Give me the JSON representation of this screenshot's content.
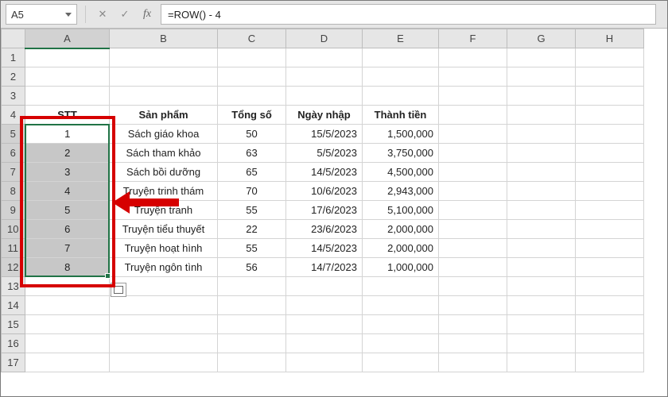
{
  "namebox": "A5",
  "formula": "=ROW() - 4",
  "columns": [
    "A",
    "B",
    "C",
    "D",
    "E",
    "F",
    "G",
    "H"
  ],
  "row_count": 17,
  "headers": {
    "stt": "STT",
    "sanpham": "Sản phẩm",
    "tongso": "Tổng số",
    "ngaynhap": "Ngày nhập",
    "thanhtien": "Thành tiền"
  },
  "rows": [
    {
      "stt": "1",
      "sp": "Sách giáo khoa",
      "ts": "50",
      "ng": "15/5/2023",
      "tt": "1,500,000"
    },
    {
      "stt": "2",
      "sp": "Sách tham khảo",
      "ts": "63",
      "ng": "5/5/2023",
      "tt": "3,750,000"
    },
    {
      "stt": "3",
      "sp": "Sách bồi dưỡng",
      "ts": "65",
      "ng": "14/5/2023",
      "tt": "4,500,000"
    },
    {
      "stt": "4",
      "sp": "Truyện trinh thám",
      "ts": "70",
      "ng": "10/6/2023",
      "tt": "2,943,000"
    },
    {
      "stt": "5",
      "sp": "Truyện tranh",
      "ts": "55",
      "ng": "17/6/2023",
      "tt": "5,100,000"
    },
    {
      "stt": "6",
      "sp": "Truyện tiểu thuyết",
      "ts": "22",
      "ng": "23/6/2023",
      "tt": "2,000,000"
    },
    {
      "stt": "7",
      "sp": "Truyện hoạt hình",
      "ts": "55",
      "ng": "14/5/2023",
      "tt": "2,000,000"
    },
    {
      "stt": "8",
      "sp": "Truyện ngôn tình",
      "ts": "56",
      "ng": "14/7/2023",
      "tt": "1,000,000"
    }
  ],
  "chart_data": {
    "type": "table",
    "columns": [
      "STT",
      "Sản phẩm",
      "Tổng số",
      "Ngày nhập",
      "Thành tiền"
    ],
    "rows": [
      [
        1,
        "Sách giáo khoa",
        50,
        "15/5/2023",
        1500000
      ],
      [
        2,
        "Sách tham khảo",
        63,
        "5/5/2023",
        3750000
      ],
      [
        3,
        "Sách bồi dưỡng",
        65,
        "14/5/2023",
        4500000
      ],
      [
        4,
        "Truyện trinh thám",
        70,
        "10/6/2023",
        2943000
      ],
      [
        5,
        "Truyện tranh",
        55,
        "17/6/2023",
        5100000
      ],
      [
        6,
        "Truyện tiểu thuyết",
        22,
        "23/6/2023",
        2000000
      ],
      [
        7,
        "Truyện hoạt hình",
        55,
        "14/5/2023",
        2000000
      ],
      [
        8,
        "Truyện ngôn tình",
        56,
        "14/7/2023",
        1000000
      ]
    ]
  }
}
